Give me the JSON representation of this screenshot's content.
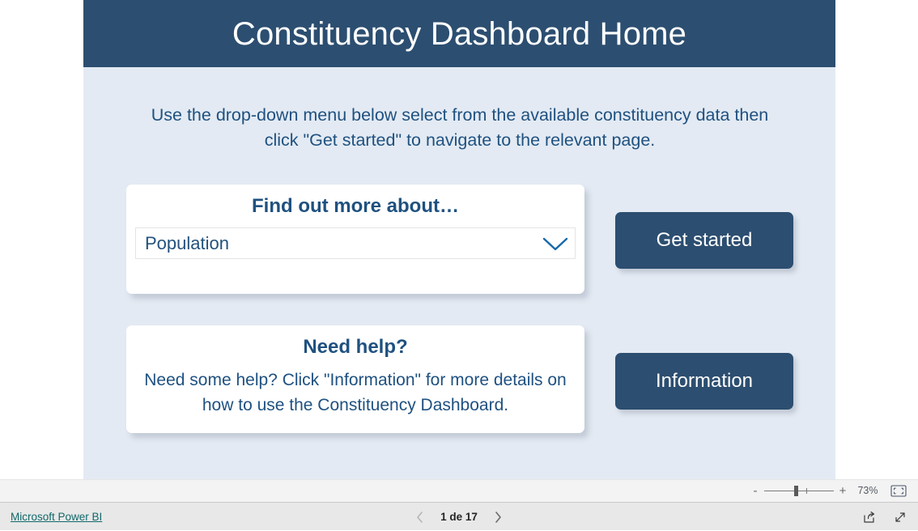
{
  "report": {
    "header": {
      "title": "Constituency Dashboard Home",
      "background_color": "#2c4e70",
      "text_color": "#ffffff"
    },
    "page_background_color": "#e3eaf3",
    "accent_color": "#1f5180",
    "intro_text": "Use the drop-down menu below select from the available constituency data then click \"Get started\" to navigate to the relevant page.",
    "dropdown_card": {
      "title": "Find out more about…",
      "selected_value": "Population",
      "chevron_icon": "chevron-down-icon"
    },
    "get_started_button": {
      "label": "Get started"
    },
    "help_card": {
      "title": "Need help?",
      "body": "Need some help? Click \"Information\" for more details on how to use the Constituency Dashboard."
    },
    "information_button": {
      "label": "Information"
    }
  },
  "zoom_bar": {
    "minus_label": "-",
    "plus_label": "+",
    "zoom_level": "73%",
    "fit_icon": "fit-to-page-icon"
  },
  "status_bar": {
    "powerbi_link": "Microsoft Power BI",
    "previous_icon": "chevron-left-icon",
    "page_indicator": "1 de 17",
    "next_icon": "chevron-right-icon",
    "share_icon": "share-icon",
    "fullscreen_icon": "fullscreen-icon"
  }
}
